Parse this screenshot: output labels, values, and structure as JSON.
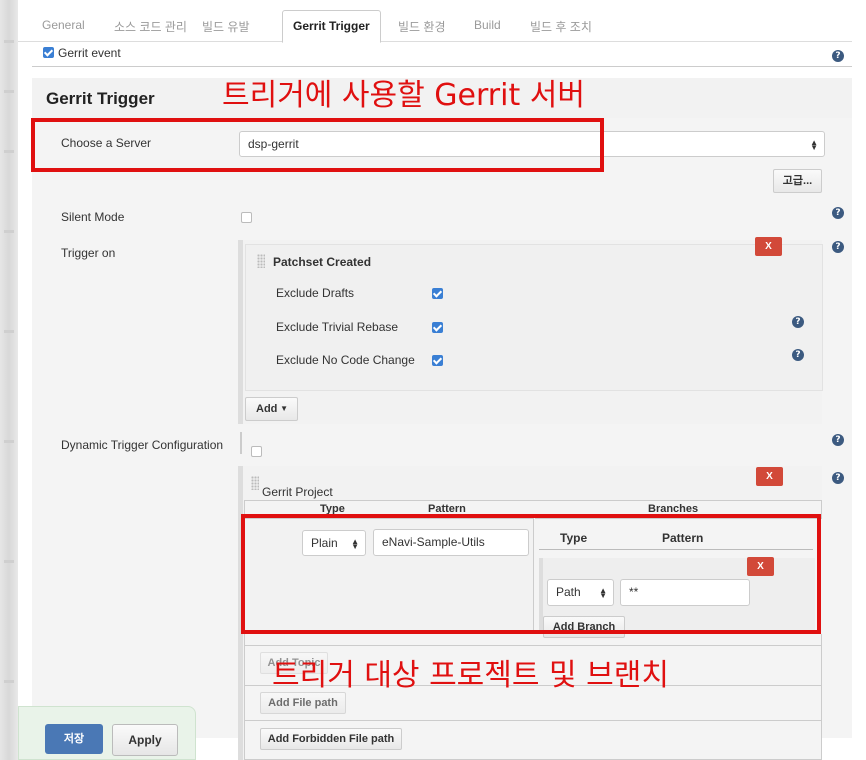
{
  "tabs": [
    "General",
    "소스 코드 관리",
    "빌드 유발",
    "Gerrit Trigger",
    "빌드 환경",
    "Build",
    "빌드 후 조치"
  ],
  "gerrit_event": {
    "label": "Gerrit event",
    "checked": true
  },
  "section_title": "Gerrit Trigger",
  "annotation_server": "트리거에 사용할 Gerrit 서버",
  "annotation_project": "트리거 대상 프로젝트 및 브랜치",
  "server": {
    "label": "Choose a Server",
    "value": "dsp-gerrit",
    "advanced_label": "고급..."
  },
  "silent_mode": {
    "label": "Silent Mode",
    "checked": false
  },
  "trigger_on": {
    "label": "Trigger on",
    "patchset_title": "Patchset Created",
    "options": [
      {
        "label": "Exclude Drafts",
        "checked": true
      },
      {
        "label": "Exclude Trivial Rebase",
        "checked": true
      },
      {
        "label": "Exclude No Code Change",
        "checked": true
      }
    ],
    "add_label": "Add",
    "delete_label": "X"
  },
  "dynamic": {
    "label": "Dynamic Trigger Configuration",
    "checked": false
  },
  "project": {
    "title": "Gerrit Project",
    "col_type": "Type",
    "col_pattern": "Pattern",
    "col_branches": "Branches",
    "type_value": "Plain",
    "pattern_value": "eNavi-Sample-Utils",
    "delete_label": "X",
    "branch": {
      "col_type": "Type",
      "col_pattern": "Pattern",
      "type_value": "Path",
      "pattern_value": "**",
      "delete_label": "X",
      "add_label": "Add Branch"
    },
    "add_topic": "Add Topic",
    "add_file_path": "Add File path",
    "add_forbidden": "Add Forbidden File path"
  },
  "footer": {
    "save_label": "저장",
    "apply_label": "Apply"
  }
}
